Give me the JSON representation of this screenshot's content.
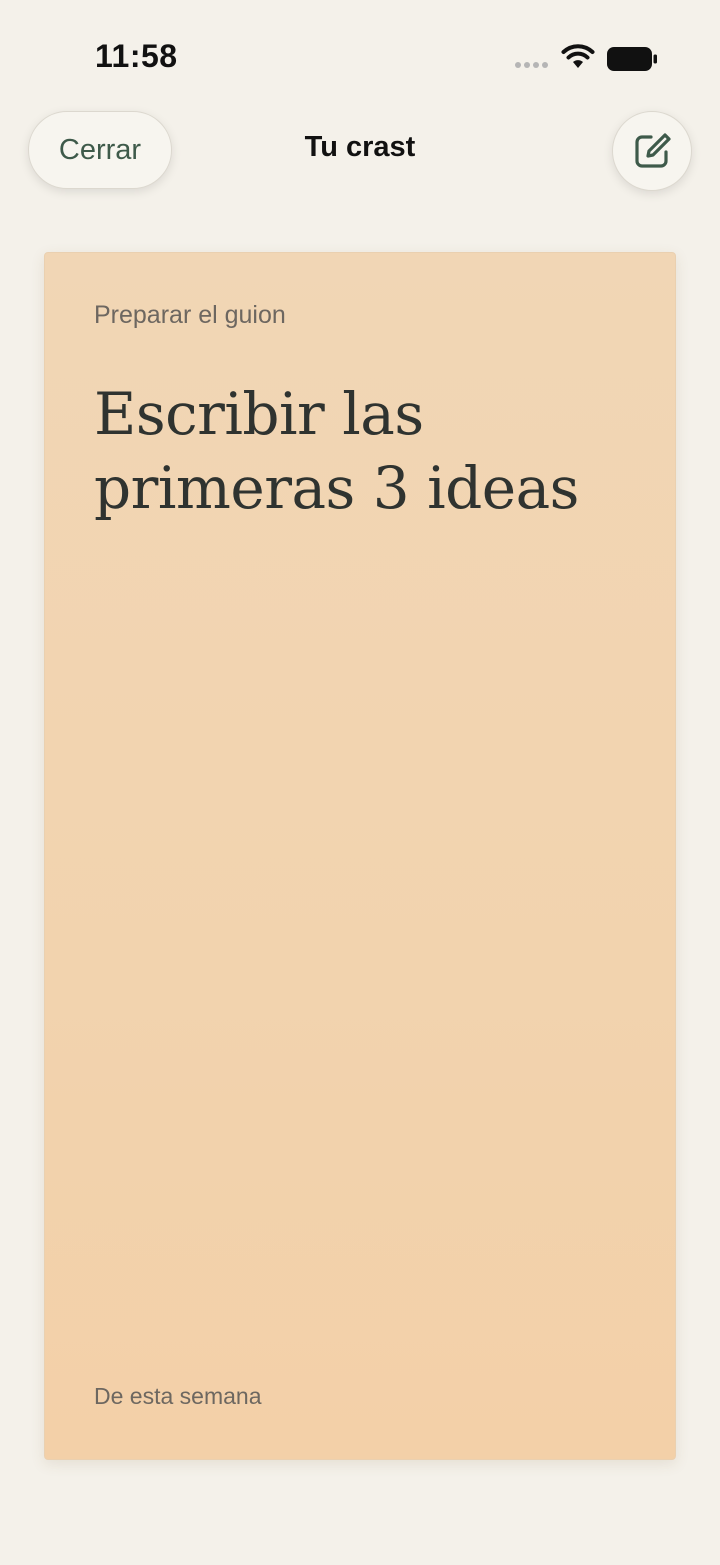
{
  "status_bar": {
    "time": "11:58"
  },
  "header": {
    "close_label": "Cerrar",
    "title": "Tu crast",
    "edit_icon": "edit-icon"
  },
  "card": {
    "category": "Preparar el guion",
    "title": "Escribir las primeras 3 ideas",
    "footer": "De esta semana",
    "background_color": "#f2d3ae"
  },
  "colors": {
    "background": "#f4f1ea",
    "accent": "#3e5a4a"
  }
}
